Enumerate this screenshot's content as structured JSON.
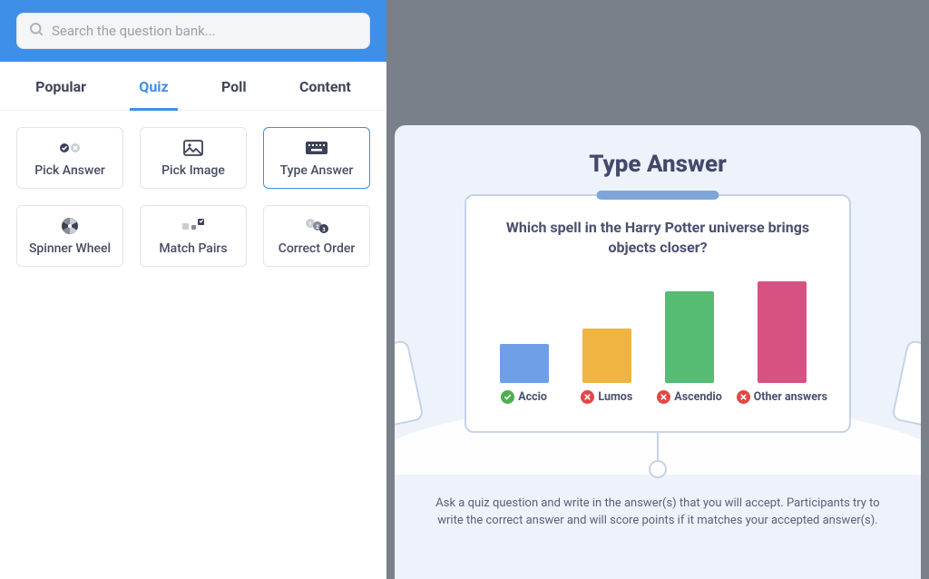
{
  "search": {
    "placeholder": "Search the question bank..."
  },
  "tabs": [
    {
      "label": "Popular",
      "active": false
    },
    {
      "label": "Quiz",
      "active": true
    },
    {
      "label": "Poll",
      "active": false
    },
    {
      "label": "Content",
      "active": false
    }
  ],
  "question_types": [
    {
      "label": "Pick Answer",
      "icon": "pick-answer-icon",
      "selected": false
    },
    {
      "label": "Pick Image",
      "icon": "pick-image-icon",
      "selected": false
    },
    {
      "label": "Type Answer",
      "icon": "keyboard-icon",
      "selected": true
    },
    {
      "label": "Spinner Wheel",
      "icon": "spinner-icon",
      "selected": false
    },
    {
      "label": "Match Pairs",
      "icon": "match-pairs-icon",
      "selected": false
    },
    {
      "label": "Correct Order",
      "icon": "numbered-icon",
      "selected": false
    }
  ],
  "preview": {
    "title": "Type Answer",
    "question": "Which spell in the Harry Potter universe brings objects closer?",
    "description": "Ask a quiz question and write in the answer(s) that you will accept. Participants try to write the correct answer and will score points if it matches your accepted answer(s)."
  },
  "chart_data": {
    "type": "bar",
    "title": "Type Answer",
    "question": "Which spell in the Harry Potter universe brings objects closer?",
    "categories": [
      "Accio",
      "Lumos",
      "Ascendio",
      "Other answers"
    ],
    "correct": [
      true,
      false,
      false,
      false
    ],
    "values": [
      50,
      70,
      118,
      130
    ],
    "colors": [
      "#6f9fe6",
      "#f0b443",
      "#56bb73",
      "#d85183"
    ],
    "ylim": [
      0,
      140
    ],
    "xlabel": "",
    "ylabel": ""
  }
}
